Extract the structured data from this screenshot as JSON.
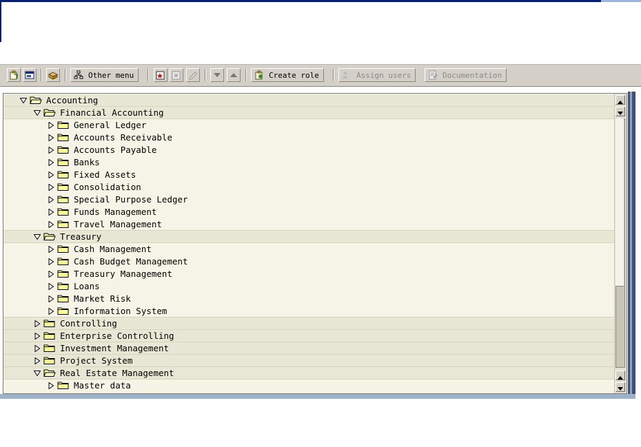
{
  "toolbar": {
    "other_menu_label": "Other menu",
    "create_role_label": "Create role",
    "assign_users_label": "Assign users",
    "documentation_label": "Documentation"
  },
  "tree": {
    "rows": [
      {
        "label": "Accounting",
        "level": 0,
        "expanded": true,
        "shade": true
      },
      {
        "label": "Financial Accounting",
        "level": 1,
        "expanded": true,
        "shade": true
      },
      {
        "label": "General Ledger",
        "level": 2,
        "expanded": false,
        "shade": false
      },
      {
        "label": "Accounts Receivable",
        "level": 2,
        "expanded": false,
        "shade": false
      },
      {
        "label": "Accounts Payable",
        "level": 2,
        "expanded": false,
        "shade": false
      },
      {
        "label": "Banks",
        "level": 2,
        "expanded": false,
        "shade": false
      },
      {
        "label": "Fixed Assets",
        "level": 2,
        "expanded": false,
        "shade": false
      },
      {
        "label": "Consolidation",
        "level": 2,
        "expanded": false,
        "shade": false
      },
      {
        "label": "Special Purpose Ledger",
        "level": 2,
        "expanded": false,
        "shade": false
      },
      {
        "label": "Funds Management",
        "level": 2,
        "expanded": false,
        "shade": false
      },
      {
        "label": "Travel Management",
        "level": 2,
        "expanded": false,
        "shade": false
      },
      {
        "label": "Treasury",
        "level": 1,
        "expanded": true,
        "shade": true
      },
      {
        "label": "Cash Management",
        "level": 2,
        "expanded": false,
        "shade": false
      },
      {
        "label": "Cash Budget Management",
        "level": 2,
        "expanded": false,
        "shade": false
      },
      {
        "label": "Treasury Management",
        "level": 2,
        "expanded": false,
        "shade": false
      },
      {
        "label": "Loans",
        "level": 2,
        "expanded": false,
        "shade": false
      },
      {
        "label": "Market Risk",
        "level": 2,
        "expanded": false,
        "shade": false
      },
      {
        "label": "Information System",
        "level": 2,
        "expanded": false,
        "shade": false
      },
      {
        "label": "Controlling",
        "level": 1,
        "expanded": false,
        "shade": true
      },
      {
        "label": "Enterprise Controlling",
        "level": 1,
        "expanded": false,
        "shade": true
      },
      {
        "label": "Investment Management",
        "level": 1,
        "expanded": false,
        "shade": true
      },
      {
        "label": "Project System",
        "level": 1,
        "expanded": false,
        "shade": true
      },
      {
        "label": "Real Estate Management",
        "level": 1,
        "expanded": true,
        "shade": true
      },
      {
        "label": "Master data",
        "level": 2,
        "expanded": false,
        "shade": false
      }
    ]
  },
  "colors": {
    "tree_background": "#f6f4e6",
    "tree_shade": "#e8e6d4",
    "folder_fill": "#ffff99",
    "toolbar_bg": "#d4d0c8"
  },
  "icons": {
    "expanded": "triangle-down-icon",
    "collapsed": "triangle-right-icon",
    "folder_open": "folder-open-icon",
    "folder_closed": "folder-icon"
  }
}
